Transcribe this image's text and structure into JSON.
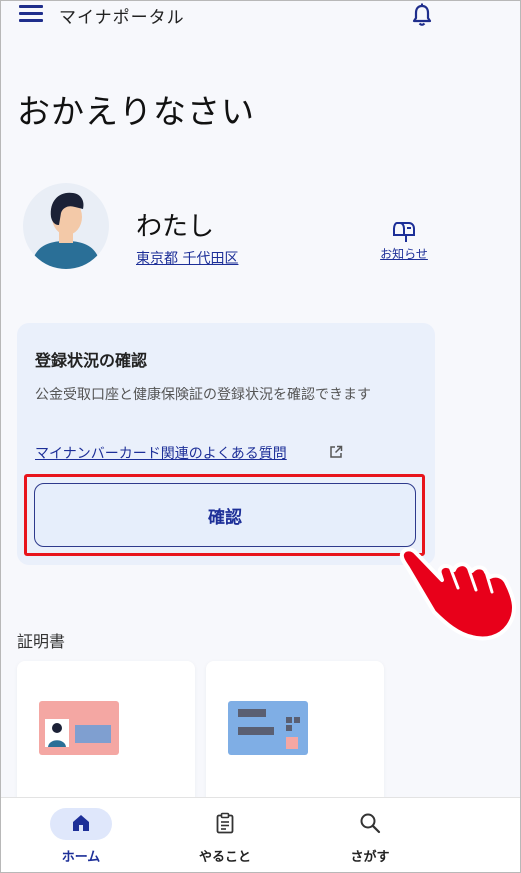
{
  "header": {
    "title": "マイナポータル",
    "menu_icon": "hamburger-menu-icon",
    "notification_icon": "bell-icon"
  },
  "greeting": "おかえりなさい",
  "user": {
    "name": "わたし",
    "address": "東京都 千代田区",
    "notice_label": "お知らせ",
    "notice_icon": "mailbox-icon"
  },
  "registration_card": {
    "title": "登録状況の確認",
    "description": "公金受取口座と健康保険証の登録状況を確認できます",
    "faq_link": "マイナンバーカード関連のよくある質問",
    "external_icon": "external-link-icon",
    "confirm_button": "確認"
  },
  "certificates": {
    "section_title": "証明書"
  },
  "bottom_nav": {
    "items": [
      {
        "label": "ホーム",
        "icon": "home-icon"
      },
      {
        "label": "やること",
        "icon": "clipboard-icon"
      },
      {
        "label": "さがす",
        "icon": "search-icon"
      }
    ]
  },
  "colors": {
    "accent": "#1d2f98",
    "highlight": "#e8141c",
    "card_bg": "#eaf0fb"
  }
}
